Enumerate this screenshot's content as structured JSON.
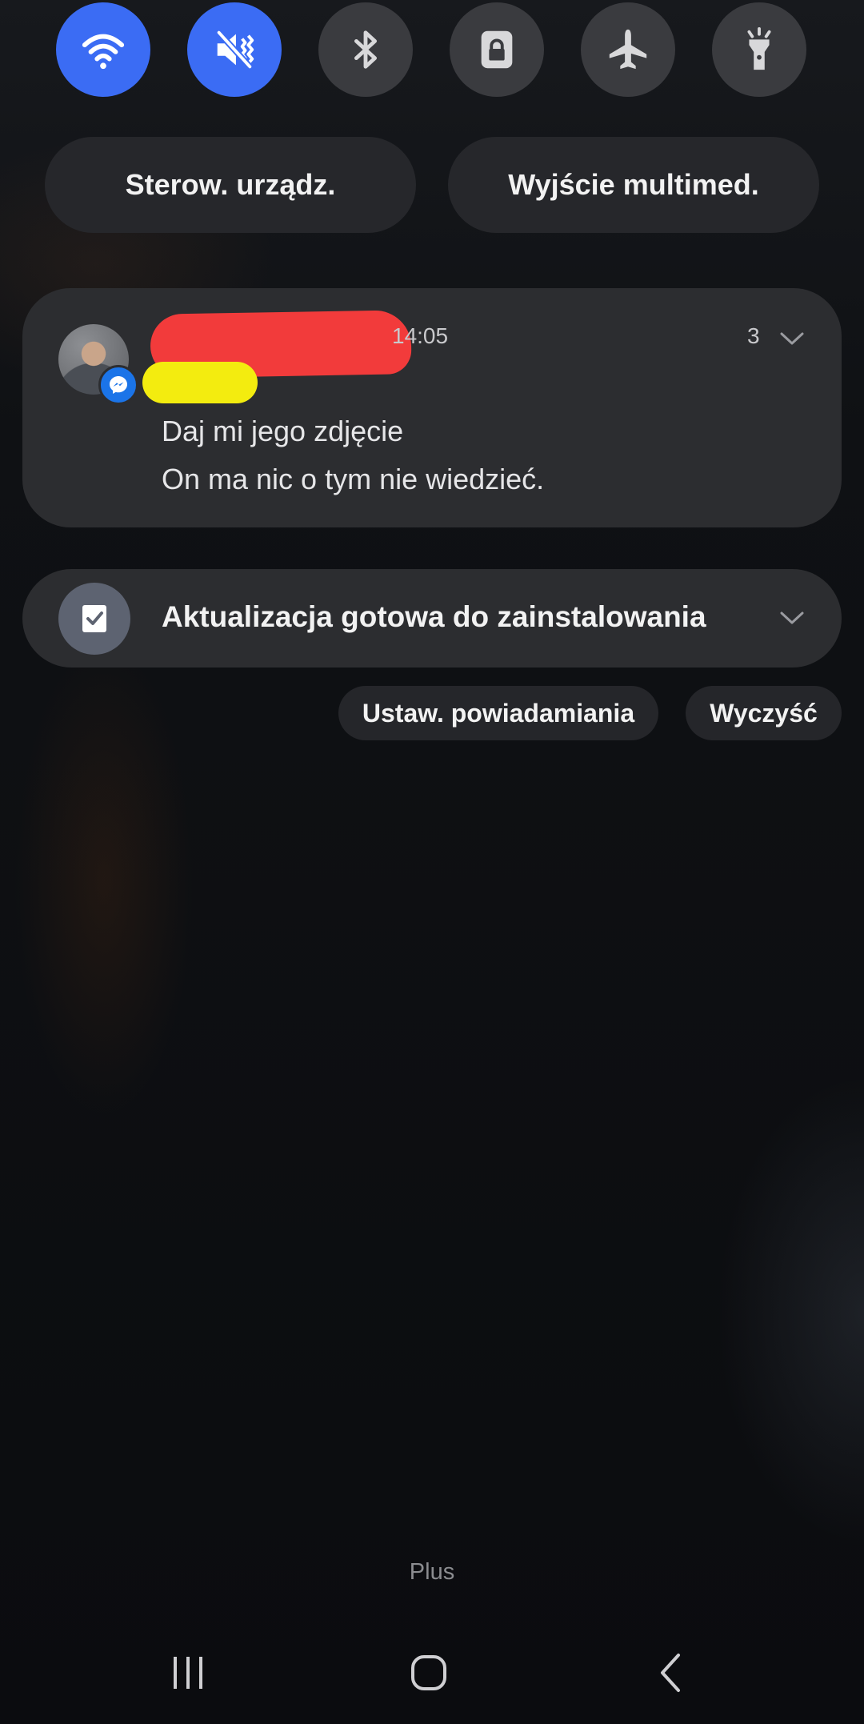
{
  "quick_toggles": [
    {
      "icon": "wifi-icon",
      "state": "on"
    },
    {
      "icon": "sound-mute-icon",
      "state": "on"
    },
    {
      "icon": "bluetooth-icon",
      "state": "off"
    },
    {
      "icon": "lock-icon",
      "state": "off"
    },
    {
      "icon": "airplane-icon",
      "state": "off"
    },
    {
      "icon": "flashlight-icon",
      "state": "off"
    }
  ],
  "panel_buttons": {
    "device_control": "Sterow. urządz.",
    "media_output": "Wyjście multimed."
  },
  "message_notification": {
    "app_icon": "messenger-icon",
    "time": "14:05",
    "count": "3",
    "lines": [
      "Daj mi jego zdjęcie",
      "On ma nic o tym nie wiedzieć."
    ]
  },
  "update_notification": {
    "icon": "checklist-icon",
    "text": "Aktualizacja gotowa do zainstalowania"
  },
  "actions": {
    "notification_settings": "Ustaw. powiadamiania",
    "clear": "Wyczyść"
  },
  "carrier": "Plus",
  "colors": {
    "toggle_on": "#3b6cf4",
    "toggle_off": "#3a3b3f",
    "card": "#2c2d30",
    "messenger_badge": "#1b74e8"
  }
}
